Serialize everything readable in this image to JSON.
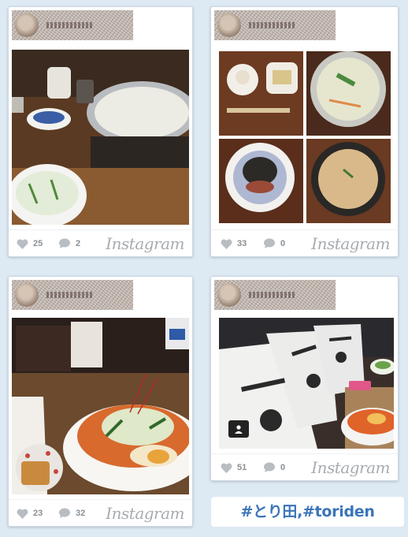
{
  "brand_label": "Instagram",
  "posts": [
    {
      "likes": "25",
      "comments": "2"
    },
    {
      "likes": "33",
      "comments": "0"
    },
    {
      "likes": "23",
      "comments": "32"
    },
    {
      "likes": "51",
      "comments": "0"
    }
  ],
  "hashtag": "#とり田,#toriden",
  "icons": {
    "like": "heart-icon",
    "comment": "comment-bubble-icon",
    "profile": "person-tag-icon"
  },
  "colors": {
    "background": "#dde9f3",
    "hashtag": "#3b74b8",
    "stat_text": "#8a8f94"
  }
}
